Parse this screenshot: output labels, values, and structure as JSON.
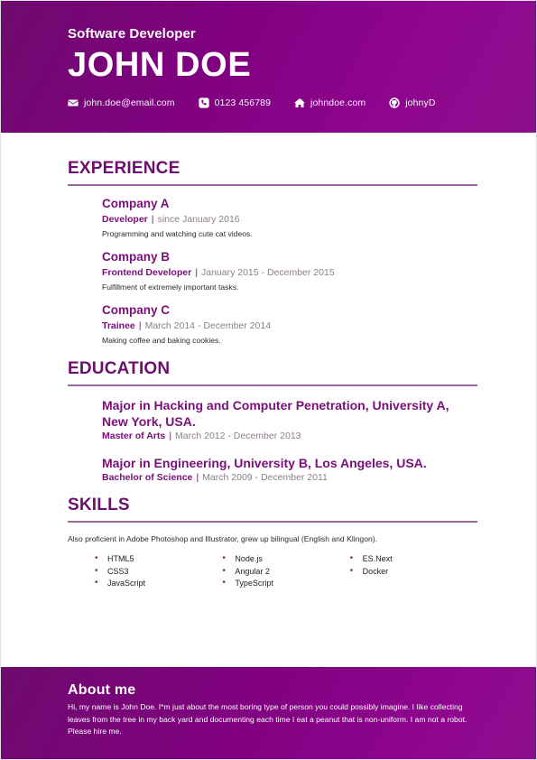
{
  "header": {
    "job_title": "Software Developer",
    "full_name": "JOHN DOE",
    "accent_color": "#800080",
    "contacts": [
      {
        "icon": "envelope-icon",
        "text": "john.doe@email.com"
      },
      {
        "icon": "phone-icon",
        "text": "0123 456789"
      },
      {
        "icon": "home-icon",
        "text": "johndoe.com"
      },
      {
        "icon": "github-icon",
        "text": "johnyD"
      }
    ]
  },
  "sections": {
    "experience": {
      "title": "EXPERIENCE",
      "entries": [
        {
          "company": "Company A",
          "role": "Developer",
          "separator": "|",
          "date": "since January 2016",
          "description": "Programming and watching cute cat videos."
        },
        {
          "company": "Company B",
          "role": "Frontend Developer",
          "separator": "|",
          "date": "January 2015 - December 2015",
          "description": "Fulfillment of extremely important tasks."
        },
        {
          "company": "Company C",
          "role": "Trainee",
          "separator": "|",
          "date": "March 2014 - December 2014",
          "description": "Making coffee and baking cookies."
        }
      ]
    },
    "education": {
      "title": "EDUCATION",
      "entries": [
        {
          "school": "Major in Hacking and Computer Penetration, University A, New York, USA.",
          "degree": "Master of Arts",
          "separator": "|",
          "date": "March 2012 - December 2013"
        },
        {
          "school": "Major in Engineering, University B, Los Angeles, USA.",
          "degree": "Bachelor of Science",
          "separator": "|",
          "date": "March 2009 - December 2011"
        }
      ]
    },
    "skills": {
      "title": "SKILLS",
      "note": "Also proficient in Adobe Photoshop and Illustrator, grew up bilingual (English and Klingon).",
      "columns": [
        [
          "HTML5",
          "CSS3",
          "JavaScript"
        ],
        [
          "Node.js",
          "Angular 2",
          "TypeScript"
        ],
        [
          "ES.Next",
          "Docker"
        ]
      ]
    }
  },
  "footer": {
    "title": "About me",
    "text": "Hi, my name is John Doe. I*m just about the most boring type of person you could possibly imagine. I like collecting leaves from the tree in my back yard and documenting each time I eat a peanut that is non-uniform. I am not a robot. Please hire me."
  }
}
